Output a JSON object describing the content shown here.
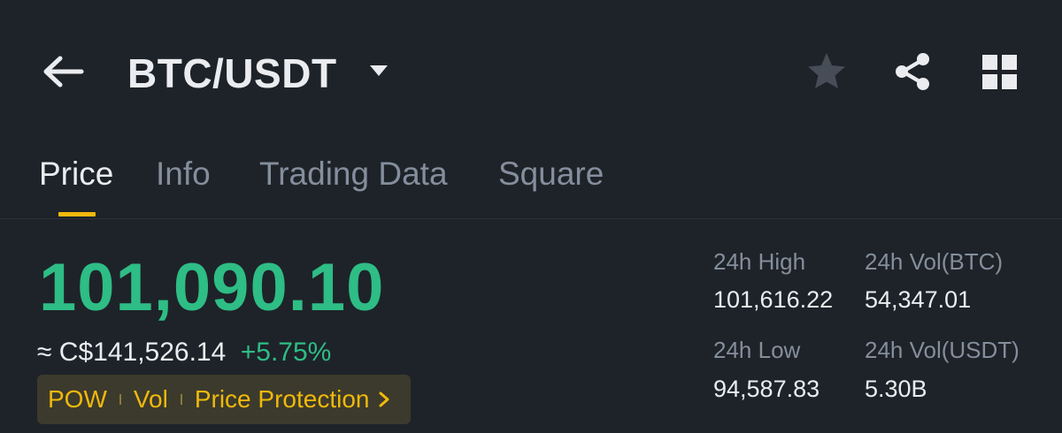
{
  "header": {
    "back_icon": "arrow-left-icon",
    "pair": "BTC/USDT",
    "pair_dropdown_icon": "caret-down-icon",
    "favorite_icon": "star-icon",
    "share_icon": "share-icon",
    "layout_icon": "grid-icon"
  },
  "tabs": [
    {
      "label": "Price",
      "active": true
    },
    {
      "label": "Info",
      "active": false
    },
    {
      "label": "Trading Data",
      "active": false
    },
    {
      "label": "Square",
      "active": false
    }
  ],
  "price": {
    "last": "101,090.10",
    "fiat": "≈ C$141,526.14",
    "change": "+5.75%"
  },
  "tags": {
    "items": [
      "POW",
      "Vol",
      "Price Protection"
    ],
    "chevron_icon": "chevron-right-icon"
  },
  "stats": {
    "high_label": "24h High",
    "high_value": "101,616.22",
    "vol_btc_label": "24h Vol(BTC)",
    "vol_btc_value": "54,347.01",
    "low_label": "24h Low",
    "low_value": "94,587.83",
    "vol_usdt_label": "24h Vol(USDT)",
    "vol_usdt_value": "5.30B"
  },
  "colors": {
    "background": "#1e2329",
    "positive": "#2ebd85",
    "accent": "#f0b90b",
    "muted_text": "#848e9c",
    "primary_text": "#eaecef"
  }
}
